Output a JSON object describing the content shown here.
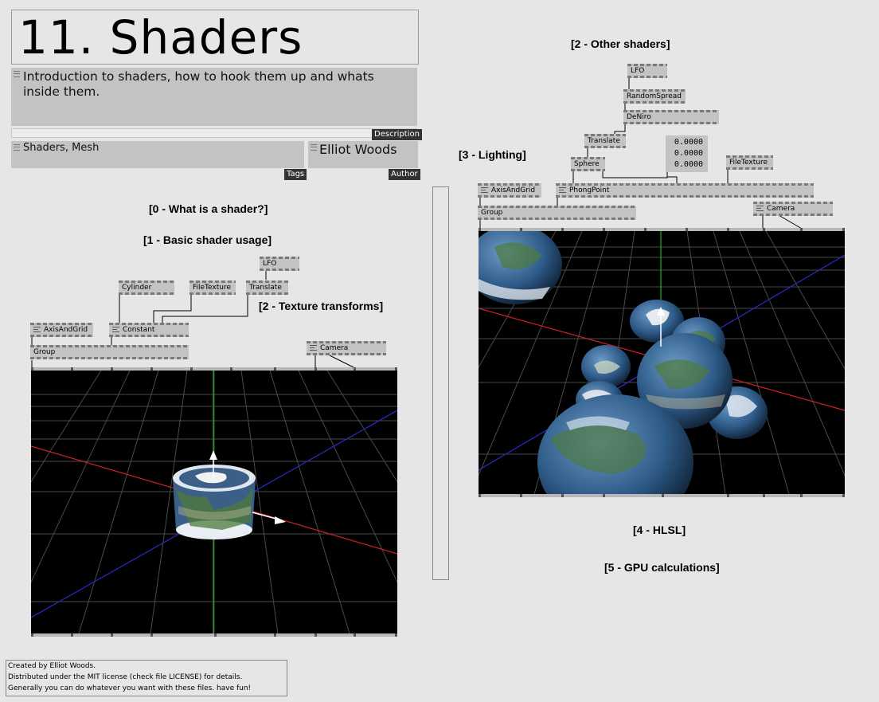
{
  "header": {
    "title": "11. Shaders",
    "description": "Introduction to shaders, how to hook them up and whats inside them.",
    "description_tag": "Description",
    "tags_value": "Shaders, Mesh",
    "tags_tag": "Tags",
    "author_value": "Elliot Woods",
    "author_tag": "Author"
  },
  "sections": {
    "s0": "[0 - What is a shader?]",
    "s1": "[1 - Basic shader usage]",
    "s2_texture": "[2 - Texture transforms]",
    "s2_other": "[2 - Other shaders]",
    "s3": "[3 - Lighting]",
    "s4": "[4 - HLSL]",
    "s5": "[5 - GPU calculations]"
  },
  "patch_left": {
    "lfo": "LFO",
    "cylinder": "Cylinder",
    "filetexture": "FileTexture",
    "translate": "Translate",
    "axisandgrid": "AxisAndGrid",
    "constant": "Constant",
    "group": "Group",
    "camera": "Camera"
  },
  "patch_right": {
    "lfo": "LFO",
    "randomspread": "RandomSpread",
    "deniro": "DeNiro",
    "translate": "Translate",
    "sphere": "Sphere",
    "filetexture": "FileTexture",
    "axisandgrid": "AxisAndGrid",
    "phongpoint": "PhongPoint",
    "group": "Group",
    "camera": "Camera",
    "values": [
      "0.0000",
      "0.0000",
      "0.0000"
    ]
  },
  "license": {
    "line1": "Created by Elliot Woods.",
    "line2": "Distributed under the MIT license (check file LICENSE) for details.",
    "line3": "Generally you can do whatever you want with these files. have fun!"
  },
  "colors": {
    "background": "#e6e6e6",
    "node": "#c3c3c3",
    "renderer_bg": "#000000",
    "grid": "#555555",
    "axis_x": "#cc1f1f",
    "axis_y": "#1fa61f",
    "axis_z": "#2828c8"
  }
}
